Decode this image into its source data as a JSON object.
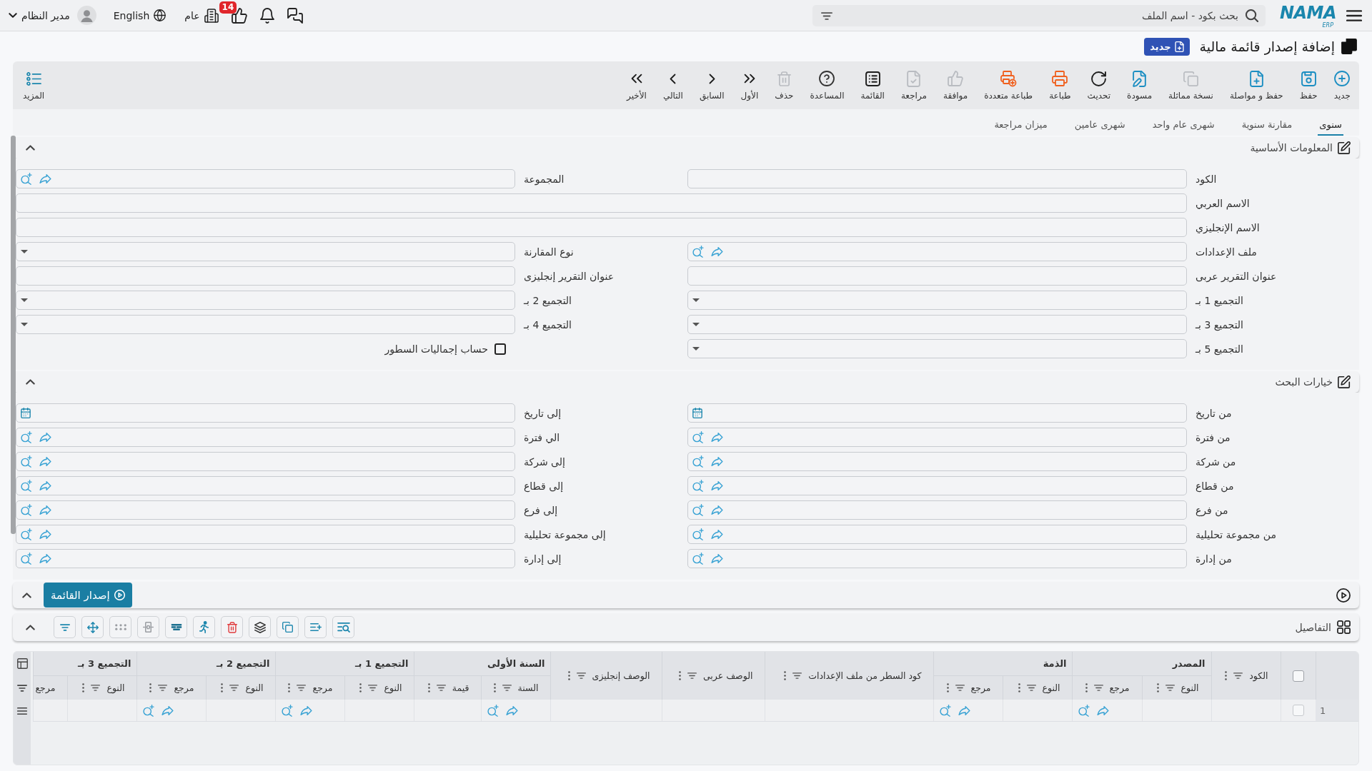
{
  "topbar": {
    "logo": "NAMA",
    "logo_sub": "ERP",
    "search": {
      "placeholder": "بحث بكود - اسم الملف"
    },
    "approvals_badge": "14",
    "company": "عام",
    "language": "English",
    "user": "مدير النظام"
  },
  "page_title": "إضافة إصدار قائمة مالية",
  "status_badge": "جديد",
  "toolbar": {
    "actions": [
      {
        "label": "جديد",
        "disabled": false
      },
      {
        "label": "حفظ",
        "disabled": false
      },
      {
        "label": "حفظ و مواصلة",
        "disabled": false
      },
      {
        "label": "نسخة مماثلة",
        "disabled": true
      },
      {
        "label": "مسودة",
        "disabled": false
      },
      {
        "label": "تحديث",
        "disabled": false
      },
      {
        "label": "طباعة",
        "disabled": false
      },
      {
        "label": "طباعة متعددة",
        "disabled": false
      },
      {
        "label": "موافقة",
        "disabled": true
      },
      {
        "label": "مراجعة",
        "disabled": true
      },
      {
        "label": "القائمة",
        "disabled": false
      },
      {
        "label": "المساعدة",
        "disabled": false
      },
      {
        "label": "حذف",
        "disabled": true
      },
      {
        "label": "الأول",
        "disabled": false
      },
      {
        "label": "السابق",
        "disabled": false
      },
      {
        "label": "التالي",
        "disabled": false
      },
      {
        "label": "الأخير",
        "disabled": false
      }
    ],
    "more": "المزيد"
  },
  "tabs": [
    {
      "label": "سنوى",
      "selected": true
    },
    {
      "label": "مقارنة سنوية",
      "selected": false
    },
    {
      "label": "شهرى عام واحد",
      "selected": false
    },
    {
      "label": "شهرى عامين",
      "selected": false
    },
    {
      "label": "ميزان مراجعة",
      "selected": false
    }
  ],
  "basic_info": {
    "title": "المعلومات الأساسية",
    "expanded": true,
    "rows": [
      {
        "fields": [
          {
            "label": "الكود",
            "kind": "text"
          },
          {
            "label": "المجموعة",
            "kind": "lookup"
          }
        ]
      },
      {
        "fields": [
          {
            "label": "الاسم العربي",
            "kind": "text"
          }
        ]
      },
      {
        "fields": [
          {
            "label": "الاسم الإنجليزي",
            "kind": "text"
          }
        ]
      },
      {
        "fields": [
          {
            "label": "ملف الإعدادات",
            "kind": "lookup"
          },
          {
            "label": "نوع المقارنة",
            "kind": "select"
          }
        ]
      },
      {
        "fields": [
          {
            "label": "عنوان التقرير عربى",
            "kind": "text"
          },
          {
            "label": "عنوان التقرير إنجليزى",
            "kind": "text"
          }
        ]
      },
      {
        "fields": [
          {
            "label": "التجميع 1 بـ",
            "kind": "select"
          },
          {
            "label": "التجميع 2 بـ",
            "kind": "select"
          }
        ]
      },
      {
        "fields": [
          {
            "label": "التجميع 3 بـ",
            "kind": "select"
          },
          {
            "label": "التجميع 4 بـ",
            "kind": "select"
          }
        ]
      },
      {
        "fields": [
          {
            "label": "التجميع 5 بـ",
            "kind": "select"
          },
          {
            "label": "حساب إجماليات السطور",
            "kind": "checkbox",
            "checked": false
          }
        ]
      }
    ]
  },
  "search_options": {
    "title": "خيارات البحث",
    "expanded": true,
    "rows": [
      {
        "fields": [
          {
            "label": "من تاريخ",
            "kind": "date"
          },
          {
            "label": "إلى تاريخ",
            "kind": "date"
          }
        ]
      },
      {
        "fields": [
          {
            "label": "من فترة",
            "kind": "lookup"
          },
          {
            "label": "الي فترة",
            "kind": "lookup"
          }
        ]
      },
      {
        "fields": [
          {
            "label": "من شركة",
            "kind": "lookup"
          },
          {
            "label": "إلى شركة",
            "kind": "lookup"
          }
        ]
      },
      {
        "fields": [
          {
            "label": "من قطاع",
            "kind": "lookup"
          },
          {
            "label": "إلى قطاع",
            "kind": "lookup"
          }
        ]
      },
      {
        "fields": [
          {
            "label": "من فرع",
            "kind": "lookup"
          },
          {
            "label": "إلى فرع",
            "kind": "lookup"
          }
        ]
      },
      {
        "fields": [
          {
            "label": "من مجموعة تحليلية",
            "kind": "lookup"
          },
          {
            "label": "إلى مجموعة تحليلية",
            "kind": "lookup"
          }
        ]
      },
      {
        "fields": [
          {
            "label": "من إدارة",
            "kind": "lookup"
          },
          {
            "label": "إلى إدارة",
            "kind": "lookup"
          }
        ]
      }
    ]
  },
  "issue_bar": {
    "button": "إصدار القائمة"
  },
  "details": {
    "title": "التفاصيل",
    "expanded": true,
    "table": {
      "all_selected": false,
      "columns": [
        {
          "label": "الكود",
          "kind": "text"
        },
        {
          "label": "المصدر",
          "children": [
            {
              "label": "النوع",
              "kind": "text"
            },
            {
              "label": "مرجع",
              "kind": "lookup"
            }
          ]
        },
        {
          "label": "الذمة",
          "children": [
            {
              "label": "النوع",
              "kind": "text"
            },
            {
              "label": "مرجع",
              "kind": "lookup"
            }
          ]
        },
        {
          "label": "كود السطر من ملف الإعدادات",
          "kind": "text"
        },
        {
          "label": "الوصف عربى",
          "kind": "text"
        },
        {
          "label": "الوصف إنجليزى",
          "kind": "text"
        },
        {
          "label": "السنة الأولى",
          "children": [
            {
              "label": "السنة",
              "kind": "lookup"
            },
            {
              "label": "قيمة",
              "kind": "text"
            }
          ]
        },
        {
          "label": "التجميع 1 بـ",
          "children": [
            {
              "label": "النوع",
              "kind": "text"
            },
            {
              "label": "مرجع",
              "kind": "lookup"
            }
          ]
        },
        {
          "label": "التجميع 2 بـ",
          "children": [
            {
              "label": "النوع",
              "kind": "text"
            },
            {
              "label": "مرجع",
              "kind": "lookup"
            }
          ]
        },
        {
          "label": "التجميع 3 بـ",
          "children": [
            {
              "label": "النوع",
              "kind": "text"
            },
            {
              "label": "مرجع",
              "kind": "text"
            }
          ]
        }
      ],
      "rows": [
        {
          "number": "1",
          "selected": false
        }
      ]
    }
  }
}
